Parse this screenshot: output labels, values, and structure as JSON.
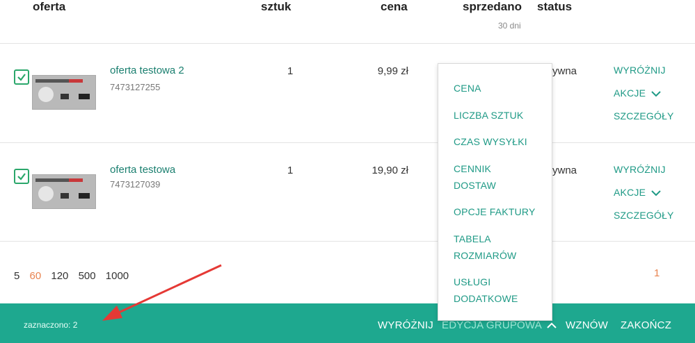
{
  "columns": {
    "offer": "oferta",
    "quantity": "sztuk",
    "price": "cena",
    "sold": "sprzedano",
    "sold_sub": "30 dni",
    "status": "status"
  },
  "rows": [
    {
      "checked": true,
      "title": "oferta testowa 2",
      "sku": "7473127255",
      "quantity": "1",
      "price": "9,99 zł",
      "status": "ywna",
      "actions": [
        "WYRÓŻNIJ",
        "AKCJE",
        "SZCZEGÓŁY"
      ]
    },
    {
      "checked": true,
      "title": "oferta testowa",
      "sku": "7473127039",
      "quantity": "1",
      "price": "19,90 zł",
      "status": "ywna",
      "actions": [
        "WYRÓŻNIJ",
        "AKCJE",
        "SZCZEGÓŁY"
      ]
    }
  ],
  "pager": {
    "sizes": [
      "5",
      "60",
      "120",
      "500",
      "1000"
    ],
    "active_size": "60",
    "current_page": "1"
  },
  "dropdown": {
    "items": [
      "CENA",
      "LICZBA SZTUK",
      "CZAS WYSYŁKI",
      "CENNIK\nDOSTAW",
      "OPCJE FAKTURY",
      "TABELA\nROZMIARÓW",
      "USŁUGI\nDODATKOWE"
    ]
  },
  "footer": {
    "selected": "zaznaczono: 2",
    "highlight": "WYRÓŻNIJ",
    "group_edit": "EDYCJA GRUPOWA",
    "resume": "WZNÓW",
    "finish": "ZAKOŃCZ"
  },
  "colors": {
    "accent": "#1ea88f",
    "link": "#1f9a86",
    "highlight": "#e8834f",
    "arrow": "#e53935"
  }
}
